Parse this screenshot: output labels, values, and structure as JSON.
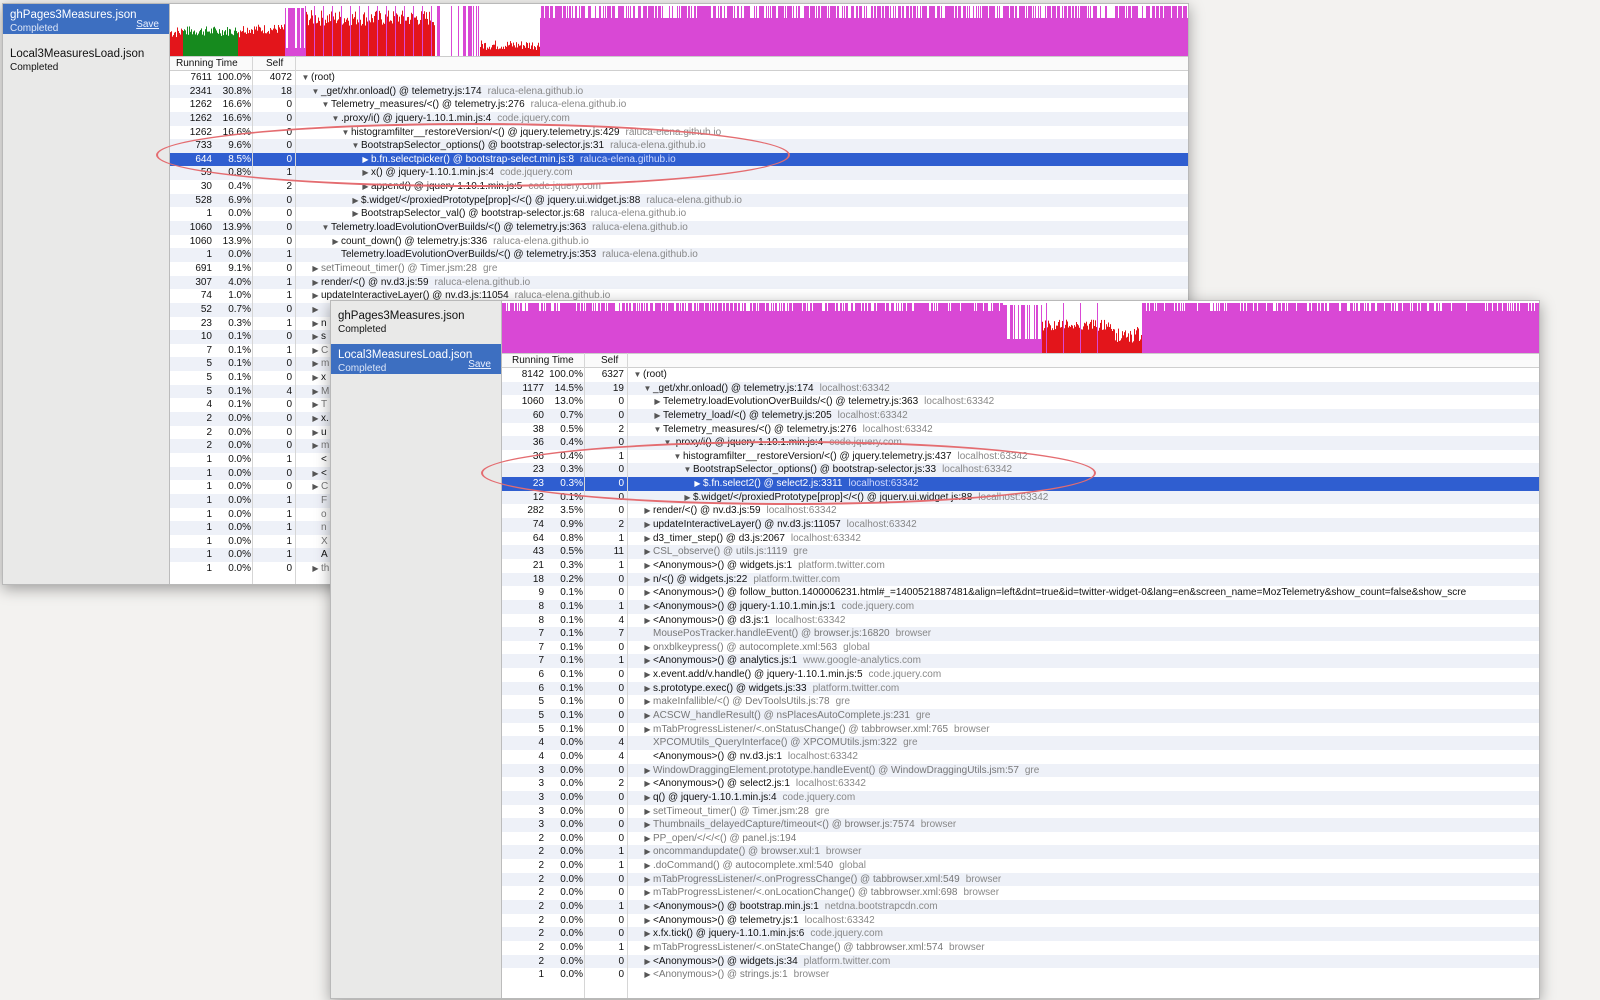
{
  "colors": {
    "selection": "#2f5ed0",
    "sidebar_selected": "#3d6fc1",
    "timeline_magenta": "#d948d5",
    "timeline_red": "#e3151b",
    "timeline_green": "#168a1e",
    "highlight_ellipse": "#e46c70"
  },
  "w1": {
    "profiles": [
      {
        "name": "ghPages3Measures.json",
        "status": "Completed",
        "save": "Save",
        "selected": true
      },
      {
        "name": "Local3MeasuresLoad.json",
        "status": "Completed",
        "save": "",
        "selected": false
      }
    ],
    "columns": {
      "running": "Running Time",
      "self": "Self"
    },
    "rows": [
      {
        "ms": "7611",
        "pct": "100.0%",
        "self": "4072",
        "depth": 0,
        "tw": "▼",
        "fn": "(root)",
        "res": ""
      },
      {
        "ms": "2341",
        "pct": "30.8%",
        "self": "18",
        "depth": 1,
        "tw": "▼",
        "fn": "_get/xhr.onload() @ telemetry.js:174",
        "res": "raluca-elena.github.io"
      },
      {
        "ms": "1262",
        "pct": "16.6%",
        "self": "0",
        "depth": 2,
        "tw": "▼",
        "fn": "Telemetry_measures/<() @ telemetry.js:276",
        "res": "raluca-elena.github.io"
      },
      {
        "ms": "1262",
        "pct": "16.6%",
        "self": "0",
        "depth": 3,
        "tw": "▼",
        "fn": ".proxy/i() @ jquery-1.10.1.min.js:4",
        "res": "code.jquery.com"
      },
      {
        "ms": "1262",
        "pct": "16.6%",
        "self": "0",
        "depth": 4,
        "tw": "▼",
        "fn": "histogramfilter__restoreVersion/<() @ jquery.telemetry.js:429",
        "res": "raluca-elena.github.io"
      },
      {
        "ms": "733",
        "pct": "9.6%",
        "self": "0",
        "depth": 5,
        "tw": "▼",
        "fn": "BootstrapSelector_options() @ bootstrap-selector.js:31",
        "res": "raluca-elena.github.io"
      },
      {
        "ms": "644",
        "pct": "8.5%",
        "self": "0",
        "depth": 6,
        "tw": "▶",
        "fn": "b.fn.selectpicker() @ bootstrap-select.min.js:8",
        "res": "raluca-elena.github.io",
        "sel": true
      },
      {
        "ms": "59",
        "pct": "0.8%",
        "self": "1",
        "depth": 6,
        "tw": "▶",
        "fn": "x() @ jquery-1.10.1.min.js:4",
        "res": "code.jquery.com"
      },
      {
        "ms": "30",
        "pct": "0.4%",
        "self": "2",
        "depth": 6,
        "tw": "▶",
        "fn": "append() @ jquery-1.10.1.min.js:5",
        "res": "code.jquery.com"
      },
      {
        "ms": "528",
        "pct": "6.9%",
        "self": "0",
        "depth": 5,
        "tw": "▶",
        "fn": "$.widget/</proxiedPrototype[prop]</<() @ jquery.ui.widget.js:88",
        "res": "raluca-elena.github.io"
      },
      {
        "ms": "1",
        "pct": "0.0%",
        "self": "0",
        "depth": 5,
        "tw": "▶",
        "fn": "BootstrapSelector_val() @ bootstrap-selector.js:68",
        "res": "raluca-elena.github.io"
      },
      {
        "ms": "1060",
        "pct": "13.9%",
        "self": "0",
        "depth": 2,
        "tw": "▼",
        "fn": "Telemetry.loadEvolutionOverBuilds/<() @ telemetry.js:363",
        "res": "raluca-elena.github.io"
      },
      {
        "ms": "1060",
        "pct": "13.9%",
        "self": "0",
        "depth": 3,
        "tw": "▶",
        "fn": "count_down() @ telemetry.js:336",
        "res": "raluca-elena.github.io"
      },
      {
        "ms": "1",
        "pct": "0.0%",
        "self": "1",
        "depth": 3,
        "tw": "",
        "fn": "Telemetry.loadEvolutionOverBuilds/<() @ telemetry.js:353",
        "res": "raluca-elena.github.io"
      },
      {
        "ms": "691",
        "pct": "9.1%",
        "self": "0",
        "depth": 1,
        "tw": "▶",
        "fn": "setTimeout_timer() @ Timer.jsm:28",
        "res": "gre",
        "dim": true
      },
      {
        "ms": "307",
        "pct": "4.0%",
        "self": "1",
        "depth": 1,
        "tw": "▶",
        "fn": "render/<() @ nv.d3.js:59",
        "res": "raluca-elena.github.io"
      },
      {
        "ms": "74",
        "pct": "1.0%",
        "self": "1",
        "depth": 1,
        "tw": "▶",
        "fn": "updateInteractiveLayer() @ nv.d3.js:11054",
        "res": "raluca-elena.github.io"
      },
      {
        "ms": "52",
        "pct": "0.7%",
        "self": "0",
        "depth": 1,
        "tw": "▶",
        "fn": "",
        "res": ""
      },
      {
        "ms": "23",
        "pct": "0.3%",
        "self": "1",
        "depth": 1,
        "tw": "▶",
        "fn": "n",
        "res": ""
      },
      {
        "ms": "10",
        "pct": "0.1%",
        "self": "0",
        "depth": 1,
        "tw": "▶",
        "fn": "s",
        "res": ""
      },
      {
        "ms": "7",
        "pct": "0.1%",
        "self": "1",
        "depth": 1,
        "tw": "▶",
        "fn": "C",
        "res": "",
        "dim": true
      },
      {
        "ms": "5",
        "pct": "0.1%",
        "self": "0",
        "depth": 1,
        "tw": "▶",
        "fn": "m",
        "res": "",
        "dim": true
      },
      {
        "ms": "5",
        "pct": "0.1%",
        "self": "0",
        "depth": 1,
        "tw": "▶",
        "fn": "x",
        "res": ""
      },
      {
        "ms": "5",
        "pct": "0.1%",
        "self": "4",
        "depth": 1,
        "tw": "▶",
        "fn": "M",
        "res": "",
        "dim": true
      },
      {
        "ms": "4",
        "pct": "0.1%",
        "self": "0",
        "depth": 1,
        "tw": "▶",
        "fn": "T",
        "res": "",
        "dim": true
      },
      {
        "ms": "2",
        "pct": "0.0%",
        "self": "0",
        "depth": 1,
        "tw": "▶",
        "fn": "x.",
        "res": ""
      },
      {
        "ms": "2",
        "pct": "0.0%",
        "self": "0",
        "depth": 1,
        "tw": "▶",
        "fn": "u",
        "res": ""
      },
      {
        "ms": "2",
        "pct": "0.0%",
        "self": "0",
        "depth": 1,
        "tw": "▶",
        "fn": "m",
        "res": "",
        "dim": true
      },
      {
        "ms": "1",
        "pct": "0.0%",
        "self": "1",
        "depth": 1,
        "tw": "",
        "fn": "<",
        "res": ""
      },
      {
        "ms": "1",
        "pct": "0.0%",
        "self": "0",
        "depth": 1,
        "tw": "▶",
        "fn": "<",
        "res": ""
      },
      {
        "ms": "1",
        "pct": "0.0%",
        "self": "0",
        "depth": 1,
        "tw": "▶",
        "fn": "C",
        "res": "",
        "dim": true
      },
      {
        "ms": "1",
        "pct": "0.0%",
        "self": "1",
        "depth": 1,
        "tw": "",
        "fn": "F",
        "res": "",
        "dim": true
      },
      {
        "ms": "1",
        "pct": "0.0%",
        "self": "1",
        "depth": 1,
        "tw": "",
        "fn": "o",
        "res": "",
        "dim": true
      },
      {
        "ms": "1",
        "pct": "0.0%",
        "self": "1",
        "depth": 1,
        "tw": "",
        "fn": "n",
        "res": "",
        "dim": true
      },
      {
        "ms": "1",
        "pct": "0.0%",
        "self": "1",
        "depth": 1,
        "tw": "",
        "fn": "X",
        "res": "",
        "dim": true
      },
      {
        "ms": "1",
        "pct": "0.0%",
        "self": "1",
        "depth": 1,
        "tw": "",
        "fn": "A",
        "res": ""
      },
      {
        "ms": "1",
        "pct": "0.0%",
        "self": "0",
        "depth": 1,
        "tw": "▶",
        "fn": "th",
        "res": "",
        "dim": true
      }
    ]
  },
  "w2": {
    "profiles": [
      {
        "name": "ghPages3Measures.json",
        "status": "Completed",
        "save": "",
        "selected": false
      },
      {
        "name": "Local3MeasuresLoad.json",
        "status": "Completed",
        "save": "Save",
        "selected": true
      }
    ],
    "columns": {
      "running": "Running Time",
      "self": "Self"
    },
    "rows": [
      {
        "ms": "8142",
        "pct": "100.0%",
        "self": "6327",
        "depth": 0,
        "tw": "▼",
        "fn": "(root)",
        "res": ""
      },
      {
        "ms": "1177",
        "pct": "14.5%",
        "self": "19",
        "depth": 1,
        "tw": "▼",
        "fn": "_get/xhr.onload() @ telemetry.js:174",
        "res": "localhost:63342"
      },
      {
        "ms": "1060",
        "pct": "13.0%",
        "self": "0",
        "depth": 2,
        "tw": "▶",
        "fn": "Telemetry.loadEvolutionOverBuilds/<() @ telemetry.js:363",
        "res": "localhost:63342"
      },
      {
        "ms": "60",
        "pct": "0.7%",
        "self": "0",
        "depth": 2,
        "tw": "▶",
        "fn": "Telemetry_load/<() @ telemetry.js:205",
        "res": "localhost:63342"
      },
      {
        "ms": "38",
        "pct": "0.5%",
        "self": "2",
        "depth": 2,
        "tw": "▼",
        "fn": "Telemetry_measures/<() @ telemetry.js:276",
        "res": "localhost:63342"
      },
      {
        "ms": "36",
        "pct": "0.4%",
        "self": "0",
        "depth": 3,
        "tw": "▼",
        "fn": ".proxy/i() @ jquery-1.10.1.min.js:4",
        "res": "code.jquery.com"
      },
      {
        "ms": "36",
        "pct": "0.4%",
        "self": "1",
        "depth": 4,
        "tw": "▼",
        "fn": "histogramfilter__restoreVersion/<() @ jquery.telemetry.js:437",
        "res": "localhost:63342"
      },
      {
        "ms": "23",
        "pct": "0.3%",
        "self": "0",
        "depth": 5,
        "tw": "▼",
        "fn": "BootstrapSelector_options() @ bootstrap-selector.js:33",
        "res": "localhost:63342"
      },
      {
        "ms": "23",
        "pct": "0.3%",
        "self": "0",
        "depth": 6,
        "tw": "▶",
        "fn": "$.fn.select2() @ select2.js:3311",
        "res": "localhost:63342",
        "sel": true
      },
      {
        "ms": "12",
        "pct": "0.1%",
        "self": "0",
        "depth": 5,
        "tw": "▶",
        "fn": "$.widget/</proxiedPrototype[prop]</<() @ jquery.ui.widget.js:88",
        "res": "localhost:63342"
      },
      {
        "ms": "282",
        "pct": "3.5%",
        "self": "0",
        "depth": 1,
        "tw": "▶",
        "fn": "render/<() @ nv.d3.js:59",
        "res": "localhost:63342"
      },
      {
        "ms": "74",
        "pct": "0.9%",
        "self": "2",
        "depth": 1,
        "tw": "▶",
        "fn": "updateInteractiveLayer() @ nv.d3.js:11057",
        "res": "localhost:63342"
      },
      {
        "ms": "64",
        "pct": "0.8%",
        "self": "1",
        "depth": 1,
        "tw": "▶",
        "fn": "d3_timer_step() @ d3.js:2067",
        "res": "localhost:63342"
      },
      {
        "ms": "43",
        "pct": "0.5%",
        "self": "11",
        "depth": 1,
        "tw": "▶",
        "fn": "CSL_observe() @ utils.js:1119",
        "res": "gre",
        "dim": true
      },
      {
        "ms": "21",
        "pct": "0.3%",
        "self": "1",
        "depth": 1,
        "tw": "▶",
        "fn": "<Anonymous>() @ widgets.js:1",
        "res": "platform.twitter.com"
      },
      {
        "ms": "18",
        "pct": "0.2%",
        "self": "0",
        "depth": 1,
        "tw": "▶",
        "fn": "n/<() @ widgets.js:22",
        "res": "platform.twitter.com"
      },
      {
        "ms": "9",
        "pct": "0.1%",
        "self": "0",
        "depth": 1,
        "tw": "▶",
        "fn": "<Anonymous>() @ follow_button.1400006231.html#_=1400521887481&align=left&dnt=true&id=twitter-widget-0&lang=en&screen_name=MozTelemetry&show_count=false&show_scre",
        "res": ""
      },
      {
        "ms": "8",
        "pct": "0.1%",
        "self": "1",
        "depth": 1,
        "tw": "▶",
        "fn": "<Anonymous>() @ jquery-1.10.1.min.js:1",
        "res": "code.jquery.com"
      },
      {
        "ms": "8",
        "pct": "0.1%",
        "self": "4",
        "depth": 1,
        "tw": "▶",
        "fn": "<Anonymous>() @ d3.js:1",
        "res": "localhost:63342"
      },
      {
        "ms": "7",
        "pct": "0.1%",
        "self": "7",
        "depth": 1,
        "tw": "",
        "fn": "MousePosTracker.handleEvent() @ browser.js:16820",
        "res": "browser",
        "dim": true
      },
      {
        "ms": "7",
        "pct": "0.1%",
        "self": "0",
        "depth": 1,
        "tw": "▶",
        "fn": "onxblkeypress() @ autocomplete.xml:563",
        "res": "global",
        "dim": true
      },
      {
        "ms": "7",
        "pct": "0.1%",
        "self": "1",
        "depth": 1,
        "tw": "▶",
        "fn": "<Anonymous>() @ analytics.js:1",
        "res": "www.google-analytics.com"
      },
      {
        "ms": "6",
        "pct": "0.1%",
        "self": "0",
        "depth": 1,
        "tw": "▶",
        "fn": "x.event.add/v.handle() @ jquery-1.10.1.min.js:5",
        "res": "code.jquery.com"
      },
      {
        "ms": "6",
        "pct": "0.1%",
        "self": "0",
        "depth": 1,
        "tw": "▶",
        "fn": "s.prototype.exec() @ widgets.js:33",
        "res": "platform.twitter.com"
      },
      {
        "ms": "5",
        "pct": "0.1%",
        "self": "0",
        "depth": 1,
        "tw": "▶",
        "fn": "makeInfallible/<() @ DevToolsUtils.js:78",
        "res": "gre",
        "dim": true
      },
      {
        "ms": "5",
        "pct": "0.1%",
        "self": "0",
        "depth": 1,
        "tw": "▶",
        "fn": "ACSCW_handleResult() @ nsPlacesAutoComplete.js:231",
        "res": "gre",
        "dim": true
      },
      {
        "ms": "5",
        "pct": "0.1%",
        "self": "0",
        "depth": 1,
        "tw": "▶",
        "fn": "mTabProgressListener/<.onStatusChange() @ tabbrowser.xml:765",
        "res": "browser",
        "dim": true
      },
      {
        "ms": "4",
        "pct": "0.0%",
        "self": "4",
        "depth": 1,
        "tw": "",
        "fn": "XPCOMUtils_QueryInterface() @ XPCOMUtils.jsm:322",
        "res": "gre",
        "dim": true
      },
      {
        "ms": "4",
        "pct": "0.0%",
        "self": "4",
        "depth": 1,
        "tw": "",
        "fn": "<Anonymous>() @ nv.d3.js:1",
        "res": "localhost:63342"
      },
      {
        "ms": "3",
        "pct": "0.0%",
        "self": "0",
        "depth": 1,
        "tw": "▶",
        "fn": "WindowDraggingElement.prototype.handleEvent() @ WindowDraggingUtils.jsm:57",
        "res": "gre",
        "dim": true
      },
      {
        "ms": "3",
        "pct": "0.0%",
        "self": "2",
        "depth": 1,
        "tw": "▶",
        "fn": "<Anonymous>() @ select2.js:1",
        "res": "localhost:63342"
      },
      {
        "ms": "3",
        "pct": "0.0%",
        "self": "0",
        "depth": 1,
        "tw": "▶",
        "fn": "q() @ jquery-1.10.1.min.js:4",
        "res": "code.jquery.com"
      },
      {
        "ms": "3",
        "pct": "0.0%",
        "self": "0",
        "depth": 1,
        "tw": "▶",
        "fn": "setTimeout_timer() @ Timer.jsm:28",
        "res": "gre",
        "dim": true
      },
      {
        "ms": "3",
        "pct": "0.0%",
        "self": "0",
        "depth": 1,
        "tw": "▶",
        "fn": "Thumbnails_delayedCapture/timeout<() @ browser.js:7574",
        "res": "browser",
        "dim": true
      },
      {
        "ms": "2",
        "pct": "0.0%",
        "self": "0",
        "depth": 1,
        "tw": "▶",
        "fn": "PP_open/</</<() @ panel.js:194",
        "res": "",
        "dim": true
      },
      {
        "ms": "2",
        "pct": "0.0%",
        "self": "1",
        "depth": 1,
        "tw": "▶",
        "fn": "oncommandupdate() @ browser.xul:1",
        "res": "browser",
        "dim": true
      },
      {
        "ms": "2",
        "pct": "0.0%",
        "self": "1",
        "depth": 1,
        "tw": "▶",
        "fn": ".doCommand() @ autocomplete.xml:540",
        "res": "global",
        "dim": true
      },
      {
        "ms": "2",
        "pct": "0.0%",
        "self": "0",
        "depth": 1,
        "tw": "▶",
        "fn": "mTabProgressListener/<.onProgressChange() @ tabbrowser.xml:549",
        "res": "browser",
        "dim": true
      },
      {
        "ms": "2",
        "pct": "0.0%",
        "self": "0",
        "depth": 1,
        "tw": "▶",
        "fn": "mTabProgressListener/<.onLocationChange() @ tabbrowser.xml:698",
        "res": "browser",
        "dim": true
      },
      {
        "ms": "2",
        "pct": "0.0%",
        "self": "1",
        "depth": 1,
        "tw": "▶",
        "fn": "<Anonymous>() @ bootstrap.min.js:1",
        "res": "netdna.bootstrapcdn.com"
      },
      {
        "ms": "2",
        "pct": "0.0%",
        "self": "0",
        "depth": 1,
        "tw": "▶",
        "fn": "<Anonymous>() @ telemetry.js:1",
        "res": "localhost:63342"
      },
      {
        "ms": "2",
        "pct": "0.0%",
        "self": "0",
        "depth": 1,
        "tw": "▶",
        "fn": "x.fx.tick() @ jquery-1.10.1.min.js:6",
        "res": "code.jquery.com"
      },
      {
        "ms": "2",
        "pct": "0.0%",
        "self": "1",
        "depth": 1,
        "tw": "▶",
        "fn": "mTabProgressListener/<.onStateChange() @ tabbrowser.xml:574",
        "res": "browser",
        "dim": true
      },
      {
        "ms": "2",
        "pct": "0.0%",
        "self": "0",
        "depth": 1,
        "tw": "▶",
        "fn": "<Anonymous>() @ widgets.js:34",
        "res": "platform.twitter.com"
      },
      {
        "ms": "1",
        "pct": "0.0%",
        "self": "0",
        "depth": 1,
        "tw": "▶",
        "fn": "<Anonymous>() @ strings.js:1",
        "res": "browser",
        "dim": true
      }
    ]
  }
}
